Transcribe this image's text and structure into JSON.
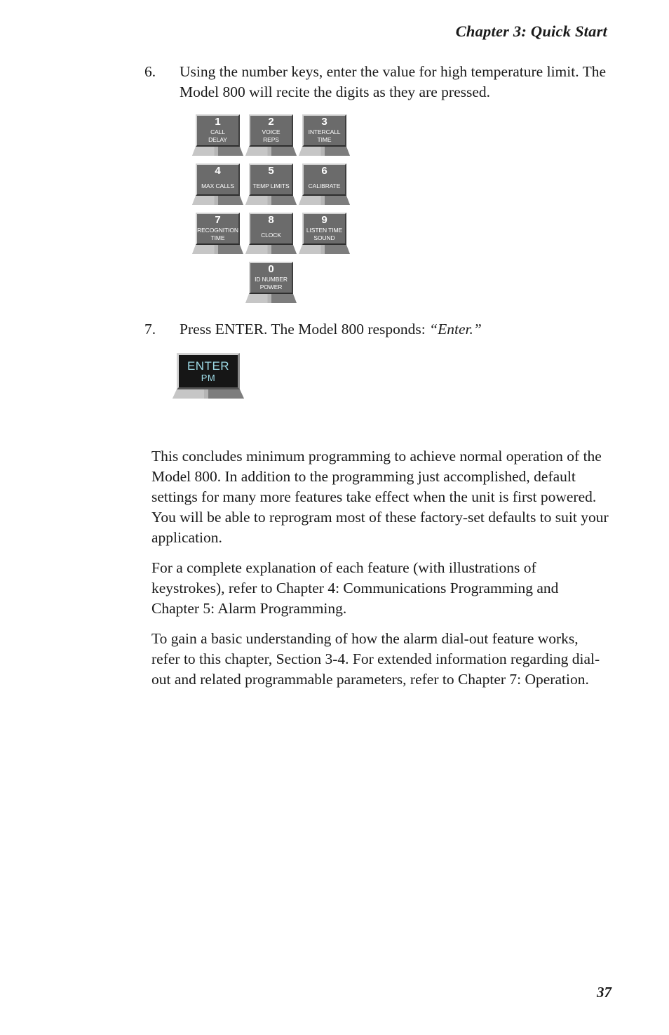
{
  "page": {
    "running_head": "Chapter 3: Quick Start",
    "folio": "37"
  },
  "steps": [
    {
      "number": "6.",
      "text": "Using the number keys, enter the value for high temperature limit. The Model 800 will recite the digits as they are pressed."
    },
    {
      "number": "7.",
      "text_before": "Press ENTER. The Model 800 responds: ",
      "text_emphasis": "“Enter.”"
    }
  ],
  "keypad": {
    "rows": [
      [
        {
          "digit": "1",
          "label_line1": "CALL",
          "label_line2": "DELAY"
        },
        {
          "digit": "2",
          "label_line1": "VOICE",
          "label_line2": "REPS"
        },
        {
          "digit": "3",
          "label_line1": "INTERCALL",
          "label_line2": "TIME"
        }
      ],
      [
        {
          "digit": "4",
          "label_line1": "MAX CALLS",
          "label_line2": ""
        },
        {
          "digit": "5",
          "label_line1": "TEMP LIMITS",
          "label_line2": ""
        },
        {
          "digit": "6",
          "label_line1": "CALIBRATE",
          "label_line2": ""
        }
      ],
      [
        {
          "digit": "7",
          "label_line1": "RECOGNITION",
          "label_line2": "TIME"
        },
        {
          "digit": "8",
          "label_line1": "CLOCK",
          "label_line2": ""
        },
        {
          "digit": "9",
          "label_line1": "LISTEN TIME",
          "label_line2": "SOUND"
        }
      ],
      [
        {
          "digit": "0",
          "label_line1": "ID NUMBER",
          "label_line2": "POWER"
        }
      ]
    ]
  },
  "enter_key": {
    "main": "ENTER",
    "sub": "PM"
  },
  "paragraphs": [
    "This concludes minimum programming to achieve normal operation of the Model 800. In addition to the programming just accomplished, default settings for many more features take effect when the unit is first powered. You will be able to reprogram most of these factory-set defaults to suit your application.",
    "For a complete explanation of each feature (with illustrations of keystrokes), refer to Chapter 4: Communications Programming and Chapter 5: Alarm Programming.",
    "To gain a basic understanding of how the alarm dial-out feature works, refer to this chapter, Section 3-4. For extended information regarding dial-out and related programmable parameters, refer to Chapter 7: Operation."
  ],
  "colors": {
    "key_face": "#6b6b6b",
    "key_text": "#ffffff",
    "enter_face": "#161616",
    "enter_text": "#9fdce8",
    "page_text": "#1a1a1a"
  }
}
